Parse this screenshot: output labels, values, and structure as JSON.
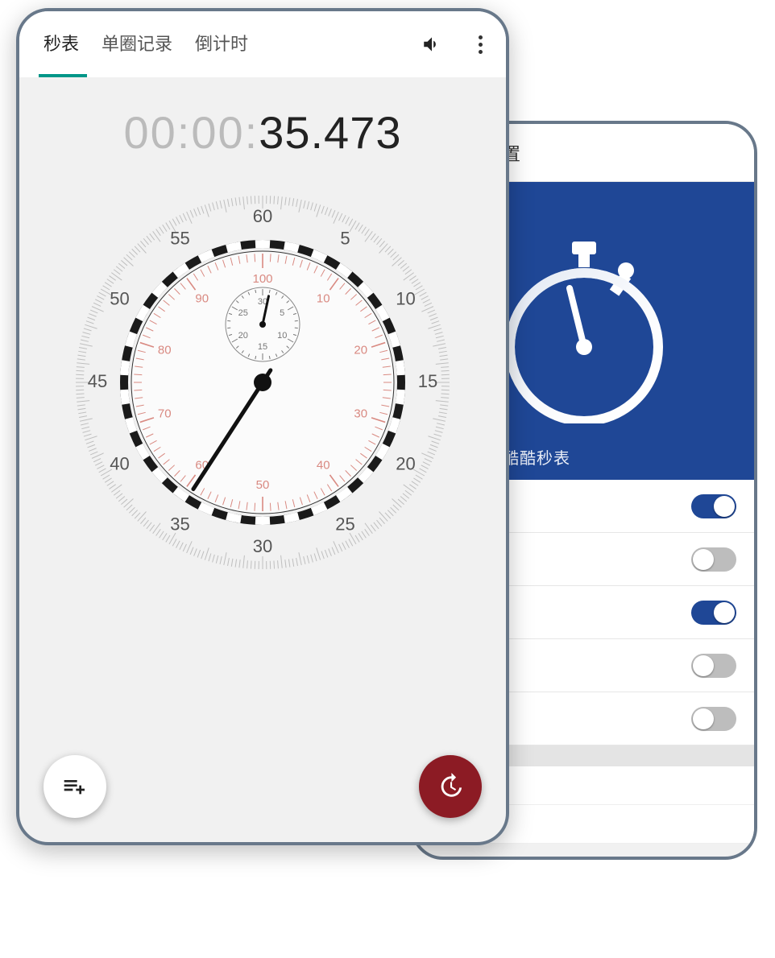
{
  "phone2": {
    "header_title": "设置",
    "app_name": "酷酷秒表",
    "toggles": [
      true,
      false,
      true,
      false,
      false
    ]
  },
  "phone1": {
    "tabs": [
      "秒表",
      "单圈记录",
      "倒计时"
    ],
    "active_tab": 0,
    "time_dim": "00:00:",
    "time_bold": "35.473",
    "dial": {
      "outer_labels": [
        "60",
        "5",
        "10",
        "15",
        "20",
        "25",
        "30",
        "35",
        "40",
        "45",
        "50",
        "55"
      ],
      "inner_labels": [
        "100",
        "10",
        "20",
        "30",
        "40",
        "50",
        "60",
        "70",
        "80",
        "90"
      ],
      "sub_labels": [
        "30",
        "5",
        "10",
        "15",
        "20",
        "25"
      ],
      "seconds_hand_value": 35.5,
      "subdial_hand_value": 1
    },
    "fab_left_icon": "playlist-add-icon",
    "fab_right_icon": "history-icon"
  },
  "colors": {
    "accent_teal": "#009688",
    "accent_red": "#8c1b24",
    "accent_blue": "#1f4796"
  }
}
